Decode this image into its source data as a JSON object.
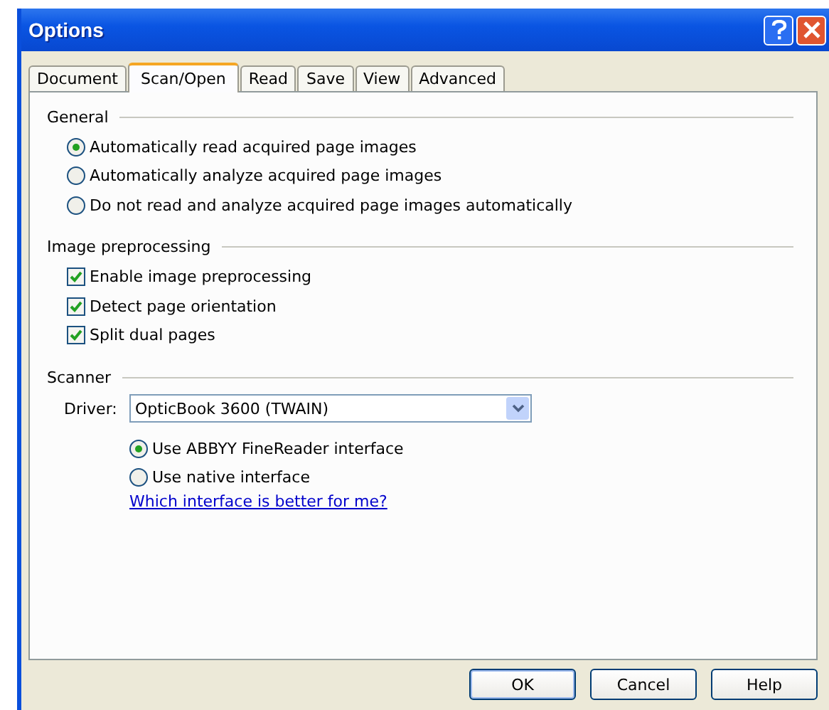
{
  "window": {
    "title": "Options"
  },
  "tabs": [
    {
      "label": "Document",
      "selected": false
    },
    {
      "label": "Scan/Open",
      "selected": true
    },
    {
      "label": "Read",
      "selected": false
    },
    {
      "label": "Save",
      "selected": false
    },
    {
      "label": "View",
      "selected": false
    },
    {
      "label": "Advanced",
      "selected": false
    }
  ],
  "general": {
    "title": "General",
    "options": [
      {
        "label": "Automatically read acquired page images",
        "selected": true
      },
      {
        "label": "Automatically analyze acquired page images",
        "selected": false
      },
      {
        "label": "Do not read and analyze acquired page images automatically",
        "selected": false
      }
    ]
  },
  "image_preprocessing": {
    "title": "Image preprocessing",
    "options": [
      {
        "label": "Enable image preprocessing",
        "checked": true
      },
      {
        "label": "Detect page orientation",
        "checked": true
      },
      {
        "label": "Split dual pages",
        "checked": true
      }
    ]
  },
  "scanner": {
    "title": "Scanner",
    "driver_label": "Driver:",
    "driver_value": "OpticBook 3600 (TWAIN)",
    "interface_options": [
      {
        "label": "Use ABBYY FineReader interface",
        "selected": true
      },
      {
        "label": "Use native interface",
        "selected": false
      }
    ],
    "help_link": "Which interface is better for me?"
  },
  "buttons": [
    "OK",
    "Cancel",
    "Help"
  ]
}
